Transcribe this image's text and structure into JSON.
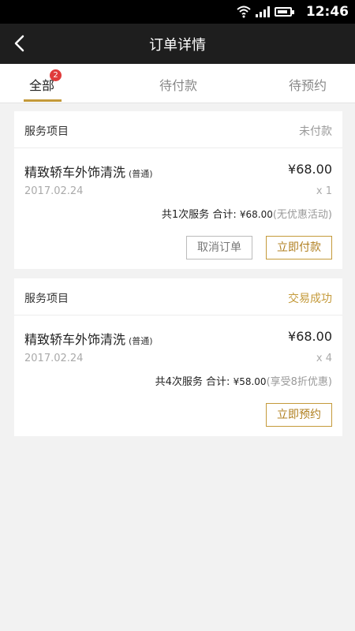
{
  "status_bar": {
    "time": "12:46"
  },
  "header": {
    "title": "订单详情"
  },
  "tabs": [
    {
      "label": "全部",
      "badge": "2",
      "active": true
    },
    {
      "label": "待付款",
      "active": false
    },
    {
      "label": "待预约",
      "active": false
    }
  ],
  "orders": [
    {
      "section_label": "服务项目",
      "status": "未付款",
      "item_name": "精致轿车外饰清洗",
      "item_tag": "(普通)",
      "price": "¥68.00",
      "date": "2017.02.24",
      "quantity": "x 1",
      "summary_count": "共1次服务",
      "summary_total_label": "合计:",
      "summary_total": "¥68.00",
      "summary_note": "(无优惠活动)",
      "buttons": {
        "cancel": "取消订单",
        "pay": "立即付款"
      }
    },
    {
      "section_label": "服务项目",
      "status": "交易成功",
      "item_name": "精致轿车外饰清洗",
      "item_tag": "(普通)",
      "price": "¥68.00",
      "date": "2017.02.24",
      "quantity": "x 4",
      "summary_count": "共4次服务",
      "summary_total_label": "合计:",
      "summary_total": "¥58.00",
      "summary_note": "(享受8折优惠)",
      "buttons": {
        "book": "立即预约"
      }
    }
  ],
  "colors": {
    "accent": "#c49a3a",
    "badge": "#e03b3b",
    "navbar": "#1e1e1e"
  },
  "icons": [
    "wifi-icon",
    "signal-icon",
    "battery-icon",
    "back-arrow-icon"
  ]
}
